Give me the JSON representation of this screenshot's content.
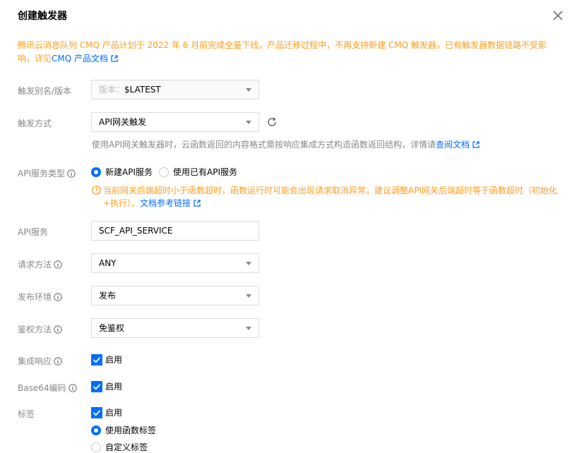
{
  "dialog": {
    "title": "创建触发器"
  },
  "notice": {
    "text": "腾讯云消息队列 CMQ 产品计划于 2022 年 6 月前完成全量下线，产品迁移过程中，不再支持新建 CMQ 触发器，已有触发器数据链路不受影响，详见",
    "link": "CMQ 产品文档"
  },
  "form": {
    "alias": {
      "label": "触发别名/版本",
      "prefix": "版本：",
      "value": "$LATEST"
    },
    "trigger_method": {
      "label": "触发方式",
      "value": "API网关触发",
      "hint": "使用API网关触发器时，云函数返回的内容格式需按响应集成方式构造函数返回结构，详情请",
      "hint_link": "查阅文档"
    },
    "api_service_type": {
      "label": "API服务类型",
      "options": [
        "新建API服务",
        "使用已有API服务"
      ],
      "selected": "新建API服务",
      "warning": "当前网关后端超时小于函数超时，函数运行时可能会出现请求取消异常，建议调整API网关后端超时等于函数超时（初始化+执行）。",
      "warning_link": "文档参考链接"
    },
    "api_service": {
      "label": "API服务",
      "value": "SCF_API_SERVICE"
    },
    "request_method": {
      "label": "请求方法",
      "value": "ANY"
    },
    "publish_env": {
      "label": "发布环境",
      "value": "发布"
    },
    "auth_method": {
      "label": "鉴权方法",
      "value": "免鉴权"
    },
    "integration_response": {
      "label": "集成响应",
      "checkbox_label": "启用",
      "checked": true
    },
    "base64": {
      "label": "Base64编码",
      "checkbox_label": "启用",
      "checked": true
    },
    "tags": {
      "label": "标签",
      "checkbox_label": "启用",
      "checked": true,
      "options": [
        "使用函数标签",
        "自定义标签"
      ],
      "selected": "使用函数标签"
    }
  },
  "colors": {
    "accent": "#006eff",
    "warning": "#ff9c19",
    "label": "#888888"
  }
}
